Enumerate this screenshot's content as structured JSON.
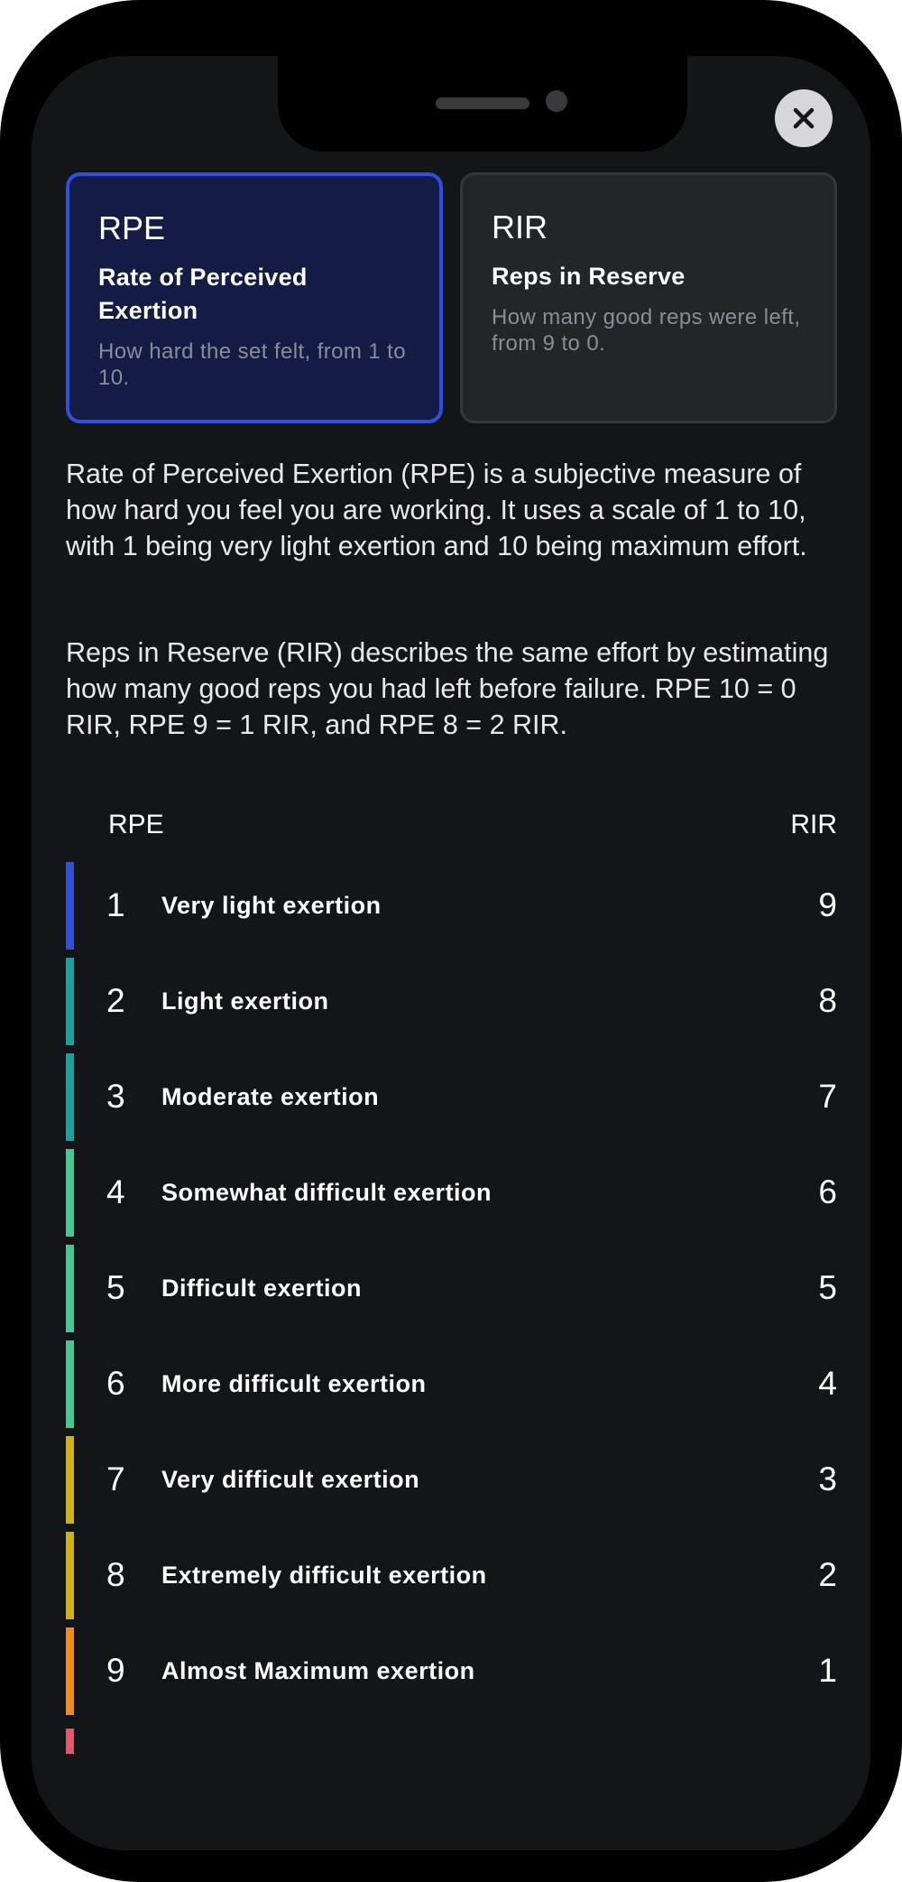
{
  "sheet": {
    "close_icon": "close-icon"
  },
  "cards": {
    "rpe": {
      "title": "RPE",
      "subtitle": "Rate of Perceived Exertion",
      "description": "How hard the set felt, from 1 to 10.",
      "selected": true,
      "accent_color": "#2f4fe0"
    },
    "rir": {
      "title": "RIR",
      "subtitle": "Reps in Reserve",
      "description": "How many good reps were left, from 9 to 0.",
      "selected": false
    }
  },
  "explanation": {
    "paragraph_1": "Rate of Perceived Exertion (RPE) is a subjective measure of how hard you feel you are working. It uses a scale of 1 to 10, with 1 being very light exertion and 10 being maximum effort.",
    "paragraph_2": "Reps in Reserve (RIR) describes the same effort by estimating how many good reps you had left before failure. RPE 10 = 0 RIR, RPE 9 = 1 RIR, and RPE 8 = 2 RIR."
  },
  "scale_table": {
    "header_rpe": "RPE",
    "header_rir": "RIR",
    "rows": [
      {
        "rpe": "1",
        "label": "Very light exertion",
        "rir": "9",
        "color": "#2f4fe0"
      },
      {
        "rpe": "2",
        "label": "Light exertion",
        "rir": "8",
        "color": "#14a3a3"
      },
      {
        "rpe": "3",
        "label": "Moderate exertion",
        "rir": "7",
        "color": "#14a3a3"
      },
      {
        "rpe": "4",
        "label": "Somewhat difficult exertion",
        "rir": "6",
        "color": "#3fcc8e"
      },
      {
        "rpe": "5",
        "label": "Difficult exertion",
        "rir": "5",
        "color": "#3fcc8e"
      },
      {
        "rpe": "6",
        "label": "More difficult exertion",
        "rir": "4",
        "color": "#3fcc8e"
      },
      {
        "rpe": "7",
        "label": "Very difficult exertion",
        "rir": "3",
        "color": "#d1b014"
      },
      {
        "rpe": "8",
        "label": "Extremely difficult exertion",
        "rir": "2",
        "color": "#d1b014"
      },
      {
        "rpe": "9",
        "label": "Almost Maximum exertion",
        "rir": "1",
        "color": "#f58a1a"
      }
    ],
    "next_row_color": "#e8566a"
  }
}
